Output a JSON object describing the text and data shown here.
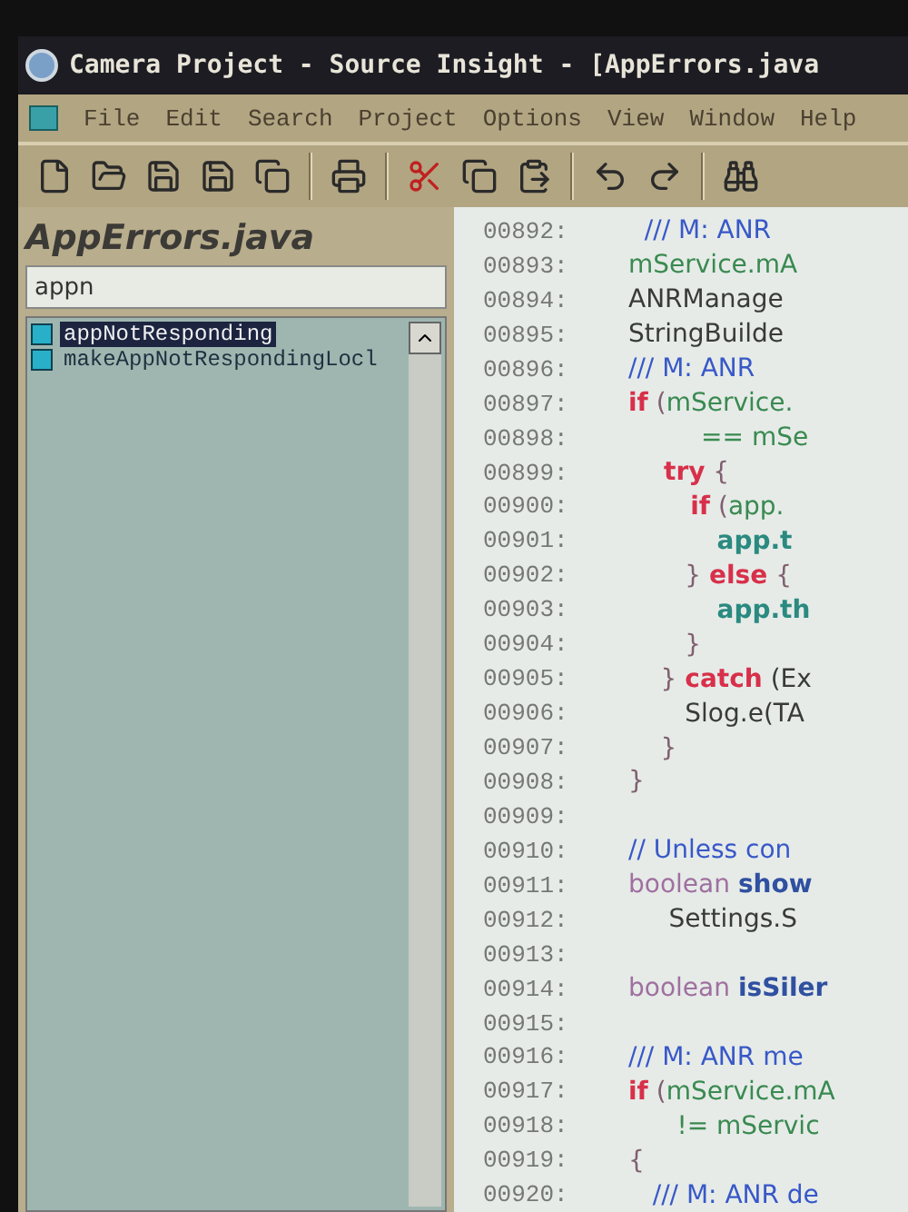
{
  "window": {
    "title": "Camera Project - Source Insight - [AppErrors.java"
  },
  "menu": [
    "File",
    "Edit",
    "Search",
    "Project",
    "Options",
    "View",
    "Window",
    "Help"
  ],
  "symbol_panel": {
    "title": "AppErrors.java",
    "search": {
      "value": "appn"
    },
    "items": [
      {
        "label": "appNotResponding",
        "selected": true
      },
      {
        "label": "makeAppNotRespondingLocl",
        "selected": false
      }
    ]
  },
  "code": {
    "lines": [
      {
        "number": "00892:",
        "tokens": [
          {
            "kind": "comment",
            "text": "  /// M: ANR"
          }
        ]
      },
      {
        "number": "00893:",
        "tokens": [
          {
            "kind": "member",
            "text": "mService.mA"
          }
        ]
      },
      {
        "number": "00894:",
        "tokens": [
          {
            "kind": "plain",
            "text": "ANRManage"
          }
        ]
      },
      {
        "number": "00895:",
        "tokens": [
          {
            "kind": "plain",
            "text": "StringBuilde"
          }
        ]
      },
      {
        "number": "00896:",
        "tokens": [
          {
            "kind": "comment",
            "text": "/// M: ANR"
          }
        ]
      },
      {
        "number": "00897:",
        "tokens": [
          {
            "kind": "keyword",
            "text": "if"
          },
          {
            "kind": "punct",
            "text": " ("
          },
          {
            "kind": "member",
            "text": "mService."
          }
        ]
      },
      {
        "number": "00898:",
        "tokens": [
          {
            "kind": "member",
            "text": "         == mSe"
          }
        ]
      },
      {
        "number": "00899:",
        "tokens": [
          {
            "kind": "keyword",
            "text": "    try"
          },
          {
            "kind": "punct",
            "text": " {"
          }
        ]
      },
      {
        "number": "00900:",
        "tokens": [
          {
            "kind": "keyword",
            "text": "       if"
          },
          {
            "kind": "punct",
            "text": " ("
          },
          {
            "kind": "member",
            "text": "app."
          }
        ]
      },
      {
        "number": "00901:",
        "tokens": [
          {
            "kind": "teal",
            "text": "          app.t"
          }
        ]
      },
      {
        "number": "00902:",
        "tokens": [
          {
            "kind": "punct",
            "text": "       } "
          },
          {
            "kind": "keyword",
            "text": "else"
          },
          {
            "kind": "punct",
            "text": " {"
          }
        ]
      },
      {
        "number": "00903:",
        "tokens": [
          {
            "kind": "teal",
            "text": "          app.th"
          }
        ]
      },
      {
        "number": "00904:",
        "tokens": [
          {
            "kind": "punct",
            "text": "       }"
          }
        ]
      },
      {
        "number": "00905:",
        "tokens": [
          {
            "kind": "punct",
            "text": "    } "
          },
          {
            "kind": "keyword",
            "text": "catch"
          },
          {
            "kind": "plain",
            "text": " (Ex"
          }
        ]
      },
      {
        "number": "00906:",
        "tokens": [
          {
            "kind": "plain",
            "text": "       Slog.e(TA"
          }
        ]
      },
      {
        "number": "00907:",
        "tokens": [
          {
            "kind": "punct",
            "text": "    }"
          }
        ]
      },
      {
        "number": "00908:",
        "tokens": [
          {
            "kind": "punct",
            "text": "}"
          }
        ]
      },
      {
        "number": "00909:"
      },
      {
        "number": "00910:",
        "tokens": [
          {
            "kind": "comment",
            "text": "// Unless con"
          }
        ]
      },
      {
        "number": "00911:",
        "tokens": [
          {
            "kind": "type",
            "text": "boolean "
          },
          {
            "kind": "bold",
            "text": "show"
          }
        ]
      },
      {
        "number": "00912:",
        "tokens": [
          {
            "kind": "plain",
            "text": "     Settings.S"
          }
        ]
      },
      {
        "number": "00913:"
      },
      {
        "number": "00914:",
        "tokens": [
          {
            "kind": "type",
            "text": "boolean "
          },
          {
            "kind": "bold",
            "text": "isSiler"
          }
        ]
      },
      {
        "number": "00915:"
      },
      {
        "number": "00916:",
        "tokens": [
          {
            "kind": "comment",
            "text": "/// M: ANR me"
          }
        ]
      },
      {
        "number": "00917:",
        "tokens": [
          {
            "kind": "keyword",
            "text": "if"
          },
          {
            "kind": "punct",
            "text": " ("
          },
          {
            "kind": "member",
            "text": "mService.mA"
          }
        ]
      },
      {
        "number": "00918:",
        "tokens": [
          {
            "kind": "member",
            "text": "      != mServic"
          }
        ]
      },
      {
        "number": "00919:",
        "tokens": [
          {
            "kind": "punct",
            "text": "{"
          }
        ]
      },
      {
        "number": "00920:",
        "tokens": [
          {
            "kind": "comment",
            "text": "   /// M: ANR de"
          }
        ]
      }
    ]
  }
}
